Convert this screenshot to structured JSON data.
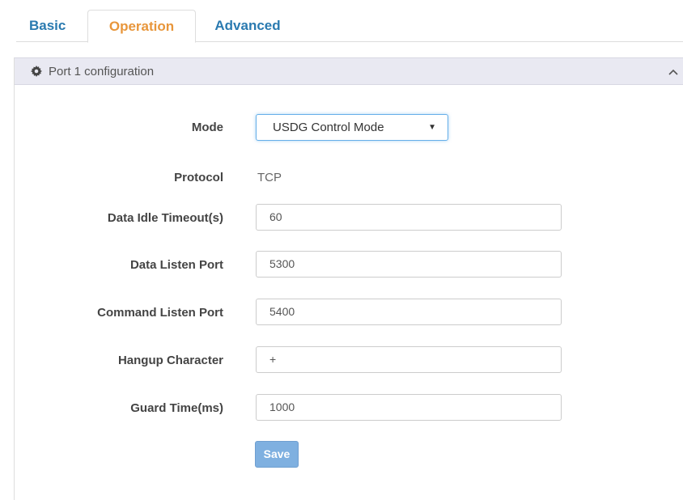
{
  "tabs": [
    {
      "label": "Basic"
    },
    {
      "label": "Operation"
    },
    {
      "label": "Advanced"
    }
  ],
  "panel": {
    "title": "Port 1 configuration",
    "icon": "gear-icon",
    "collapse_icon": "chevron-up-icon"
  },
  "form": {
    "mode": {
      "label": "Mode",
      "value": "USDG Control Mode"
    },
    "protocol": {
      "label": "Protocol",
      "value": "TCP"
    },
    "data_idle_timeout": {
      "label": "Data Idle Timeout(s)",
      "value": "60"
    },
    "data_listen_port": {
      "label": "Data Listen Port",
      "value": "5300"
    },
    "command_listen_port": {
      "label": "Command Listen Port",
      "value": "5400"
    },
    "hangup_character": {
      "label": "Hangup Character",
      "value": "+"
    },
    "guard_time": {
      "label": "Guard Time(ms)",
      "value": "1000"
    },
    "save_label": "Save"
  },
  "colors": {
    "tab_link": "#2a7ab0",
    "tab_active": "#e8963b",
    "panel_heading_bg": "#e9e9f2",
    "save_button": "#7fb0e0",
    "focus_border": "#66afe9"
  }
}
